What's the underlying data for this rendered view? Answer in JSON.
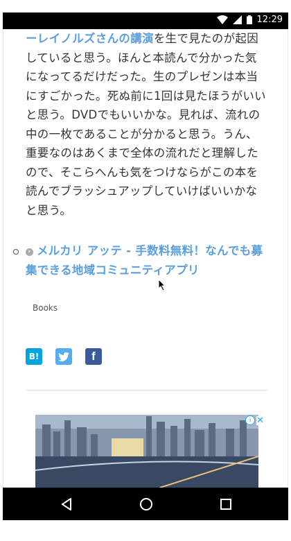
{
  "status_bar": {
    "time": "12:29",
    "icons": [
      "wifi-icon",
      "signal-icon",
      "battery-icon"
    ]
  },
  "article": {
    "link_text": "ーレイノルズさんの講演",
    "body_text": "を生で見たのが起因していると思う。ほんと本読んで分かった気になってるだけだった。生のプレゼンは本当にすごかった。死ぬ前に1回は見たほうがいいと思う。DVDでもいいかな。見れば、流れの中の一枚であることが分かると思う。うん、重要なのはあくまで全体の流れだと理解したので、そこらへんも気をつけならがこの本を読んでブラッシュアップしていけばいいかなと思う。"
  },
  "related": {
    "link_text": "メルカリ アッテ - 手数料無料！なんでも募集できる地域コミュニティアプリ"
  },
  "category": {
    "label": "Books"
  },
  "share": {
    "hatena_label": "B!",
    "twitter_icon": "twitter-bird-icon",
    "facebook_label": "f"
  },
  "ad": {
    "info_icon": "ad-info-icon",
    "close_icon": "ad-close-icon"
  },
  "nav_bar": {
    "buttons": [
      "back-icon",
      "home-icon",
      "recents-icon"
    ]
  },
  "colors": {
    "link": "#5a9fe0",
    "text": "#333333",
    "hatena": "#00a4de",
    "twitter": "#55acee",
    "facebook": "#3b5998"
  }
}
